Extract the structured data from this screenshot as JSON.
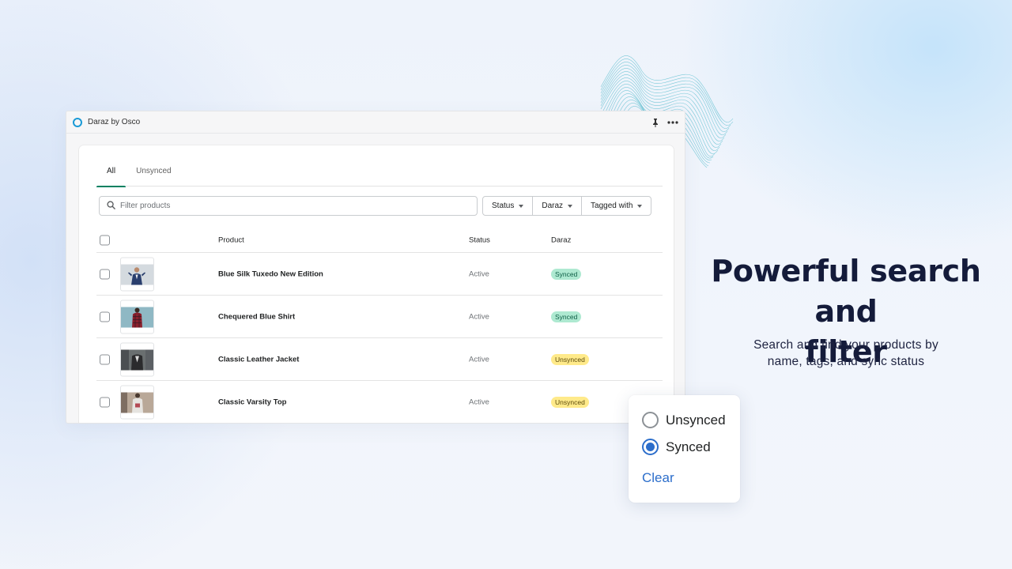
{
  "app": {
    "title": "Daraz by Osco"
  },
  "tabs": [
    {
      "label": "All"
    },
    {
      "label": "Unsynced"
    }
  ],
  "search": {
    "placeholder": "Filter products",
    "value": ""
  },
  "filters": [
    {
      "label": "Status"
    },
    {
      "label": "Daraz"
    },
    {
      "label": "Tagged with"
    }
  ],
  "table": {
    "columns": {
      "product": "Product",
      "status": "Status",
      "daraz": "Daraz"
    },
    "rows": [
      {
        "product": "Blue Silk Tuxedo New Edition",
        "status": "Active",
        "daraz": "Synced"
      },
      {
        "product": "Chequered Blue Shirt",
        "status": "Active",
        "daraz": "Synced"
      },
      {
        "product": "Classic Leather Jacket",
        "status": "Active",
        "daraz": "Unsynced"
      },
      {
        "product": "Classic Varsity Top",
        "status": "Active",
        "daraz": "Unsynced"
      }
    ]
  },
  "promo": {
    "headline_line1": "Powerful search and",
    "headline_line2": "filter",
    "subtext_line1": "Search and find your products by",
    "subtext_line2": "name, tags, and sync status"
  },
  "popover": {
    "options": [
      {
        "label": "Unsynced",
        "checked": false
      },
      {
        "label": "Synced",
        "checked": true
      }
    ],
    "clear_label": "Clear"
  },
  "colors": {
    "accent_tab": "#008060",
    "link_blue": "#2c6ecb",
    "synced_badge": "#aee9d1",
    "unsynced_badge": "#ffea8a",
    "headline": "#141b3a"
  },
  "icons": {
    "app_logo": "app-logo-icon",
    "pin": "pin-icon",
    "more": "more-icon",
    "search": "search-icon",
    "caret": "caret-down-icon"
  }
}
